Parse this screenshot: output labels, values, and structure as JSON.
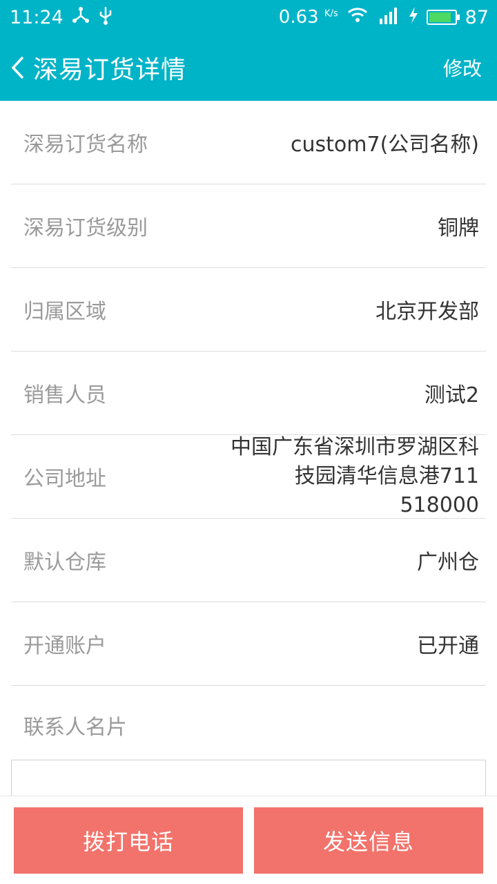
{
  "status_bar": {
    "time": "11:24",
    "speed": "0.63",
    "speed_unit": "K/s",
    "battery": "87",
    "battery_level": 0.87,
    "icons": [
      "tether-icon",
      "usb-icon",
      "wifi-icon",
      "signal-icon",
      "charging-icon",
      "battery-icon"
    ]
  },
  "header": {
    "back_icon": "chevron-left-icon",
    "title": "深易订货详情",
    "edit_label": "修改"
  },
  "details": [
    {
      "label": "深易订货名称",
      "value": "custom7(公司名称)"
    },
    {
      "label": "深易订货级别",
      "value": "铜牌"
    },
    {
      "label": "归属区域",
      "value": "北京开发部"
    },
    {
      "label": "销售人员",
      "value": "测试2"
    },
    {
      "label": "公司地址",
      "value": "中国广东省深圳市罗湖区科技园清华信息港711 518000"
    },
    {
      "label": "默认仓库",
      "value": "广州仓"
    },
    {
      "label": "开通账户",
      "value": "已开通"
    }
  ],
  "contact": {
    "label": "联系人名片"
  },
  "actions": {
    "call_label": "拨打电话",
    "message_label": "发送信息"
  },
  "colors": {
    "accent": "#00b4c8",
    "action": "#f2736b"
  }
}
